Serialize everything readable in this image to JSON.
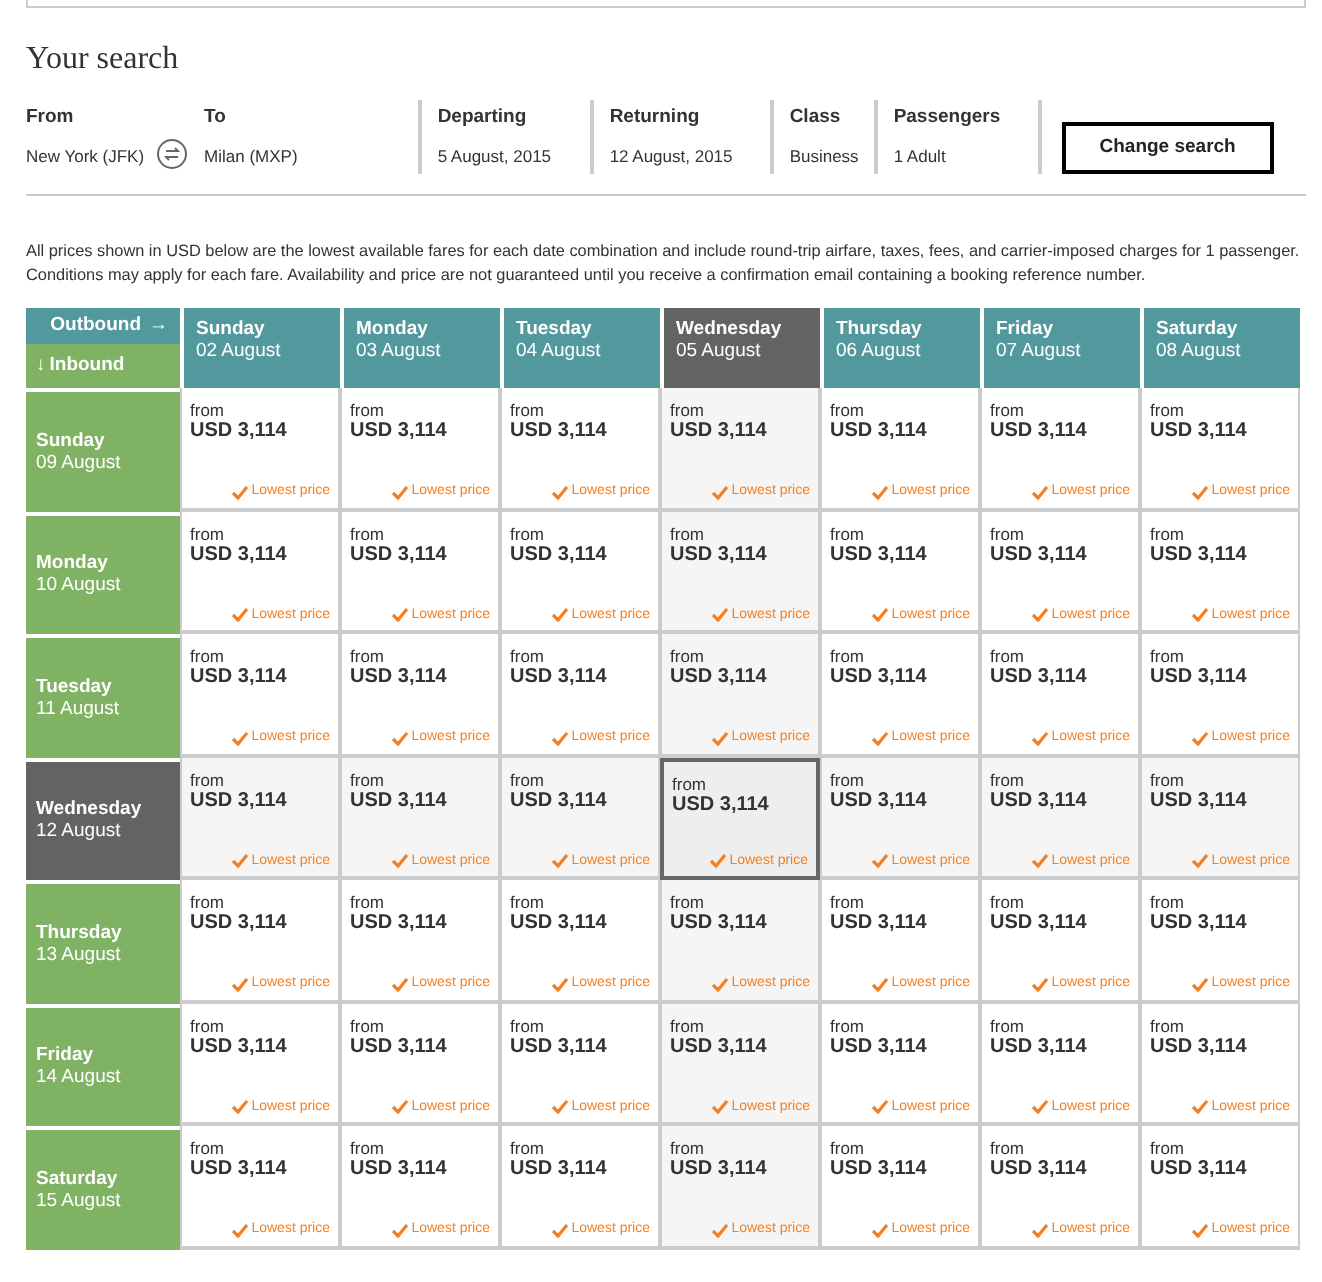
{
  "heading": "Your search",
  "route": {
    "from_label": "From",
    "from_value": "New York (JFK)",
    "to_label": "To",
    "to_value": "Milan (MXP)"
  },
  "fields": [
    {
      "label": "Departing",
      "value": "5 August, 2015"
    },
    {
      "label": "Returning",
      "value": "12 August, 2015"
    },
    {
      "label": "Class",
      "value": "Business"
    },
    {
      "label": "Passengers",
      "value": "1 Adult"
    }
  ],
  "change_button": "Change search",
  "notice": "All prices shown in USD below are the lowest available fares for each date combination and include round-trip airfare, taxes, fees, and carrier-imposed charges for 1 passenger. Conditions may apply for each fare. Availability and price are not guaranteed until you receive a confirmation email containing a booking reference number.",
  "corner": {
    "outbound": "Outbound",
    "outbound_arrow": "→",
    "inbound_arrow": "↓",
    "inbound": "Inbound"
  },
  "outbound_days": [
    {
      "day": "Sunday",
      "date": "02 August",
      "selected": false
    },
    {
      "day": "Monday",
      "date": "03 August",
      "selected": false
    },
    {
      "day": "Tuesday",
      "date": "04 August",
      "selected": false
    },
    {
      "day": "Wednesday",
      "date": "05 August",
      "selected": true
    },
    {
      "day": "Thursday",
      "date": "06 August",
      "selected": false
    },
    {
      "day": "Friday",
      "date": "07 August",
      "selected": false
    },
    {
      "day": "Saturday",
      "date": "08 August",
      "selected": false
    }
  ],
  "inbound_days": [
    {
      "day": "Sunday",
      "date": "09 August",
      "selected": false,
      "cells": [
        {
          "from": "from",
          "price": "USD 3,114",
          "note": "Lowest price"
        },
        {
          "from": "from",
          "price": "USD 3,114",
          "note": "Lowest price"
        },
        {
          "from": "from",
          "price": "USD 3,114",
          "note": "Lowest price"
        },
        {
          "from": "from",
          "price": "USD 3,114",
          "note": "Lowest price"
        },
        {
          "from": "from",
          "price": "USD 3,114",
          "note": "Lowest price"
        },
        {
          "from": "from",
          "price": "USD 3,114",
          "note": "Lowest price"
        },
        {
          "from": "from",
          "price": "USD 3,114",
          "note": "Lowest price"
        }
      ]
    },
    {
      "day": "Monday",
      "date": "10 August",
      "selected": false,
      "cells": [
        {
          "from": "from",
          "price": "USD 3,114",
          "note": "Lowest price"
        },
        {
          "from": "from",
          "price": "USD 3,114",
          "note": "Lowest price"
        },
        {
          "from": "from",
          "price": "USD 3,114",
          "note": "Lowest price"
        },
        {
          "from": "from",
          "price": "USD 3,114",
          "note": "Lowest price"
        },
        {
          "from": "from",
          "price": "USD 3,114",
          "note": "Lowest price"
        },
        {
          "from": "from",
          "price": "USD 3,114",
          "note": "Lowest price"
        },
        {
          "from": "from",
          "price": "USD 3,114",
          "note": "Lowest price"
        }
      ]
    },
    {
      "day": "Tuesday",
      "date": "11 August",
      "selected": false,
      "cells": [
        {
          "from": "from",
          "price": "USD 3,114",
          "note": "Lowest price"
        },
        {
          "from": "from",
          "price": "USD 3,114",
          "note": "Lowest price"
        },
        {
          "from": "from",
          "price": "USD 3,114",
          "note": "Lowest price"
        },
        {
          "from": "from",
          "price": "USD 3,114",
          "note": "Lowest price"
        },
        {
          "from": "from",
          "price": "USD 3,114",
          "note": "Lowest price"
        },
        {
          "from": "from",
          "price": "USD 3,114",
          "note": "Lowest price"
        },
        {
          "from": "from",
          "price": "USD 3,114",
          "note": "Lowest price"
        }
      ]
    },
    {
      "day": "Wednesday",
      "date": "12 August",
      "selected": true,
      "cells": [
        {
          "from": "from",
          "price": "USD 3,114",
          "note": "Lowest price"
        },
        {
          "from": "from",
          "price": "USD 3,114",
          "note": "Lowest price"
        },
        {
          "from": "from",
          "price": "USD 3,114",
          "note": "Lowest price"
        },
        {
          "from": "from",
          "price": "USD 3,114",
          "note": "Lowest price"
        },
        {
          "from": "from",
          "price": "USD 3,114",
          "note": "Lowest price"
        },
        {
          "from": "from",
          "price": "USD 3,114",
          "note": "Lowest price"
        },
        {
          "from": "from",
          "price": "USD 3,114",
          "note": "Lowest price"
        }
      ]
    },
    {
      "day": "Thursday",
      "date": "13 August",
      "selected": false,
      "cells": [
        {
          "from": "from",
          "price": "USD 3,114",
          "note": "Lowest price"
        },
        {
          "from": "from",
          "price": "USD 3,114",
          "note": "Lowest price"
        },
        {
          "from": "from",
          "price": "USD 3,114",
          "note": "Lowest price"
        },
        {
          "from": "from",
          "price": "USD 3,114",
          "note": "Lowest price"
        },
        {
          "from": "from",
          "price": "USD 3,114",
          "note": "Lowest price"
        },
        {
          "from": "from",
          "price": "USD 3,114",
          "note": "Lowest price"
        },
        {
          "from": "from",
          "price": "USD 3,114",
          "note": "Lowest price"
        }
      ]
    },
    {
      "day": "Friday",
      "date": "14 August",
      "selected": false,
      "cells": [
        {
          "from": "from",
          "price": "USD 3,114",
          "note": "Lowest price"
        },
        {
          "from": "from",
          "price": "USD 3,114",
          "note": "Lowest price"
        },
        {
          "from": "from",
          "price": "USD 3,114",
          "note": "Lowest price"
        },
        {
          "from": "from",
          "price": "USD 3,114",
          "note": "Lowest price"
        },
        {
          "from": "from",
          "price": "USD 3,114",
          "note": "Lowest price"
        },
        {
          "from": "from",
          "price": "USD 3,114",
          "note": "Lowest price"
        },
        {
          "from": "from",
          "price": "USD 3,114",
          "note": "Lowest price"
        }
      ]
    },
    {
      "day": "Saturday",
      "date": "15 August",
      "selected": false,
      "cells": [
        {
          "from": "from",
          "price": "USD 3,114",
          "note": "Lowest price"
        },
        {
          "from": "from",
          "price": "USD 3,114",
          "note": "Lowest price"
        },
        {
          "from": "from",
          "price": "USD 3,114",
          "note": "Lowest price"
        },
        {
          "from": "from",
          "price": "USD 3,114",
          "note": "Lowest price"
        },
        {
          "from": "from",
          "price": "USD 3,114",
          "note": "Lowest price"
        },
        {
          "from": "from",
          "price": "USD 3,114",
          "note": "Lowest price"
        },
        {
          "from": "from",
          "price": "USD 3,114",
          "note": "Lowest price"
        }
      ]
    }
  ]
}
